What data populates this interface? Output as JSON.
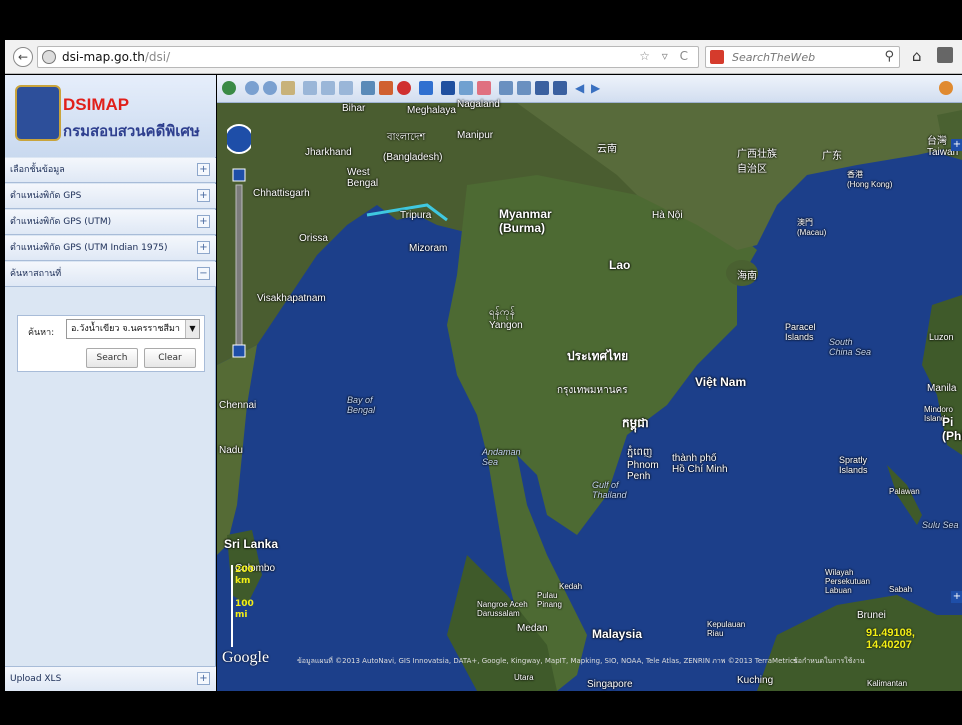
{
  "browser": {
    "url_host": "dsi-map.go.th",
    "url_path": "/dsi/",
    "search_placeholder": "SearchTheWeb",
    "url_icons": "☆ ▿ C"
  },
  "app": {
    "title": "DSIMAP",
    "subtitle": "กรมสอบสวนคดีพิเศษ"
  },
  "sidebar": {
    "items": [
      {
        "label": "เลือกชั้นข้อมูล",
        "toggle": "+"
      },
      {
        "label": "ตำแหน่งพิกัด GPS",
        "toggle": "+"
      },
      {
        "label": "ตำแหน่งพิกัด GPS (UTM)",
        "toggle": "+"
      },
      {
        "label": "ตำแหน่งพิกัด GPS (UTM Indian 1975)",
        "toggle": "+"
      },
      {
        "label": "ค้นหาสถานที่",
        "toggle": "−"
      }
    ],
    "search": {
      "label": "ค้นหา:",
      "value": "อ.วังน้ำเขียว จ.นครราชสีมา",
      "search_button": "Search",
      "clear_button": "Clear"
    },
    "upload": {
      "label": "Upload XLS",
      "toggle": "+"
    }
  },
  "map": {
    "labels": {
      "bihar": "Bihar",
      "meghalaya": "Meghalaya",
      "nagaland": "Nagaland",
      "jharkhand": "Jharkhand",
      "bangladesh_th": "বাংলাদেশ",
      "bangladesh": "(Bangladesh)",
      "manipur": "Manipur",
      "west_bengal": "West\nBengal",
      "chhattisgarh": "Chhattisgarh",
      "tripura": "Tripura",
      "orissa": "Orissa",
      "mizoram": "Mizoram",
      "myanmar": "Myanmar\n(Burma)",
      "yunnan": "云南",
      "guangxi": "广西壮族\n自治区",
      "guangdong": "广东",
      "taiwan": "台灣\nTaiwan",
      "hongkong": "香港\n(Hong Kong)",
      "macau": "澳門\n(Macau)",
      "hanoi": "Hà Nội",
      "hainan": "海南",
      "lao": "Lao",
      "visakhapatnam": "Visakhapatnam",
      "yangon": "ရန်ကုန်\nYangon",
      "thailand": "ประเทศไทย",
      "bangkok": "กรุงเทพมหานคร",
      "vietnam": "Việt Nam",
      "paracel": "Paracel\nIslands",
      "scs": "South\nChina Sea",
      "luzon": "Luzon",
      "manila": "Manila",
      "mindoro": "Mindoro\nIsland",
      "phil": "Pi\n(Phi",
      "chennai": "Chennai",
      "bay": "Bay of\nBengal",
      "cambodia": "កម្ពុជា",
      "andaman": "Andaman\nSea",
      "phnom": "ភ្នំពេញ\nPhnom\nPenh",
      "hcm": "thành phố\nHồ Chí Minh",
      "gulf": "Gulf of\nThailand",
      "nadu": "Nadu",
      "spratly": "Spratly\nIslands",
      "palawan": "Palawan",
      "sulu": "Sulu Sea",
      "srilanka": "Sri Lanka",
      "colombo": "Colombo",
      "kedah": "Kedah",
      "pulau": "Pulau\nPinang",
      "nangroe": "Nangroe Aceh\nDarussalam",
      "medan": "Medan",
      "malaysia": "Malaysia",
      "kepulauan": "Kepulauan\nRiau",
      "wilayah": "Wilayah\nPersekutuan\nLabuan",
      "sabah": "Sabah",
      "brunei": "Brunei",
      "kuching": "Kuching",
      "kalimantan": "Kalimantan",
      "singapore": "Singapore",
      "utara": "Utara"
    },
    "scale": {
      "km": "200\nkm",
      "mi": "100\nmi"
    },
    "google": "Google",
    "attribution": "ข้อมูลแผนที่ ©2013 AutoNavi, GIS Innovatsia, DATA+, Google, Kingway, MapIT, Mapking, SIO, NOAA, Tele Atlas, ZENRIN ภาพ ©2013 TerraMetrics",
    "terms": "ข้อกำหนดในการใช้งาน",
    "coords": "91.49108, 14.40207"
  },
  "colors": {
    "land": "#3f5a2a",
    "sea": "#1c3f8a",
    "accent_red": "#e0201b",
    "accent_blue": "#2e3f8f"
  }
}
